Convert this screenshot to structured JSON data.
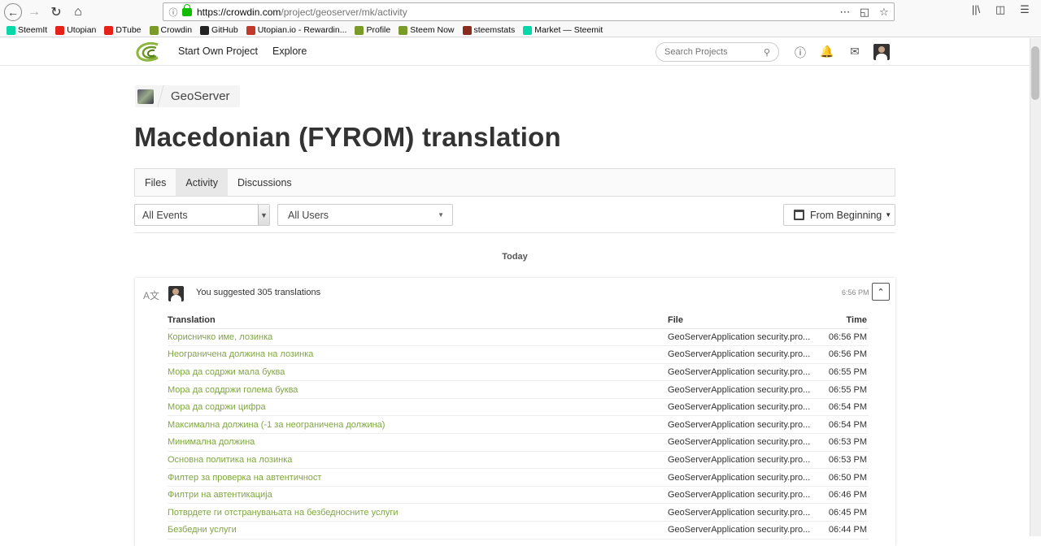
{
  "browser": {
    "url_host": "https://crowdin.com",
    "url_path": "/project/geoserver/mk/activity",
    "bookmarks": [
      {
        "label": "SteemIt",
        "color": "#07d7a9"
      },
      {
        "label": "Utopian",
        "color": "#e62117"
      },
      {
        "label": "DTube",
        "color": "#e62117"
      },
      {
        "label": "Crowdin",
        "color": "#7a9a2a"
      },
      {
        "label": "GitHub",
        "color": "#222222"
      },
      {
        "label": "Utopian.io - Rewardin...",
        "color": "#c0392b"
      },
      {
        "label": "Profile",
        "color": "#7a9a2a"
      },
      {
        "label": "Steem Now",
        "color": "#7a9a2a"
      },
      {
        "label": "steemstats",
        "color": "#8b2b1e"
      },
      {
        "label": "Market — Steemit",
        "color": "#07d7a9"
      }
    ]
  },
  "header": {
    "start_project": "Start Own Project",
    "explore": "Explore",
    "search_placeholder": "Search Projects"
  },
  "breadcrumb": {
    "project": "GeoServer"
  },
  "page": {
    "title": "Macedonian (FYROM) translation",
    "tabs": [
      {
        "label": "Files",
        "active": false
      },
      {
        "label": "Activity",
        "active": true
      },
      {
        "label": "Discussions",
        "active": false
      }
    ]
  },
  "filters": {
    "events": "All Events",
    "users": "All Users",
    "date": "From Beginning"
  },
  "feed": {
    "day": "Today",
    "event": {
      "summary": "You suggested 305 translations",
      "timestamp": "6:56 PM",
      "columns": {
        "translation": "Translation",
        "file": "File",
        "time": "Time"
      },
      "rows": [
        {
          "translation": "Корисничко име, лозинка",
          "file": "GeoServerApplication security.pro...",
          "time": "06:56 PM"
        },
        {
          "translation": "Неограничена должина на лозинка",
          "file": "GeoServerApplication security.pro...",
          "time": "06:56 PM"
        },
        {
          "translation": "Мора да содржи мала буква",
          "file": "GeoServerApplication security.pro...",
          "time": "06:55 PM"
        },
        {
          "translation": "Мора да соддржи голема буква",
          "file": "GeoServerApplication security.pro...",
          "time": "06:55 PM"
        },
        {
          "translation": "Мора да содржи цифра",
          "file": "GeoServerApplication security.pro...",
          "time": "06:54 PM"
        },
        {
          "translation": "Максимална должина (-1 за неограничена должина)",
          "file": "GeoServerApplication security.pro...",
          "time": "06:54 PM"
        },
        {
          "translation": "Минимална должина",
          "file": "GeoServerApplication security.pro...",
          "time": "06:53 PM"
        },
        {
          "translation": "Основна политика на лозинка",
          "file": "GeoServerApplication security.pro...",
          "time": "06:53 PM"
        },
        {
          "translation": "Филтер за проверка на автентичност",
          "file": "GeoServerApplication security.pro...",
          "time": "06:50 PM"
        },
        {
          "translation": "Филтри на автентикација",
          "file": "GeoServerApplication security.pro...",
          "time": "06:46 PM"
        },
        {
          "translation": "Потврдете ги отстранувањата на безбедносните услуги",
          "file": "GeoServerApplication security.pro...",
          "time": "06:45 PM"
        },
        {
          "translation": "Безбедни услуги",
          "file": "GeoServerApplication security.pro...",
          "time": "06:44 PM"
        }
      ]
    }
  }
}
